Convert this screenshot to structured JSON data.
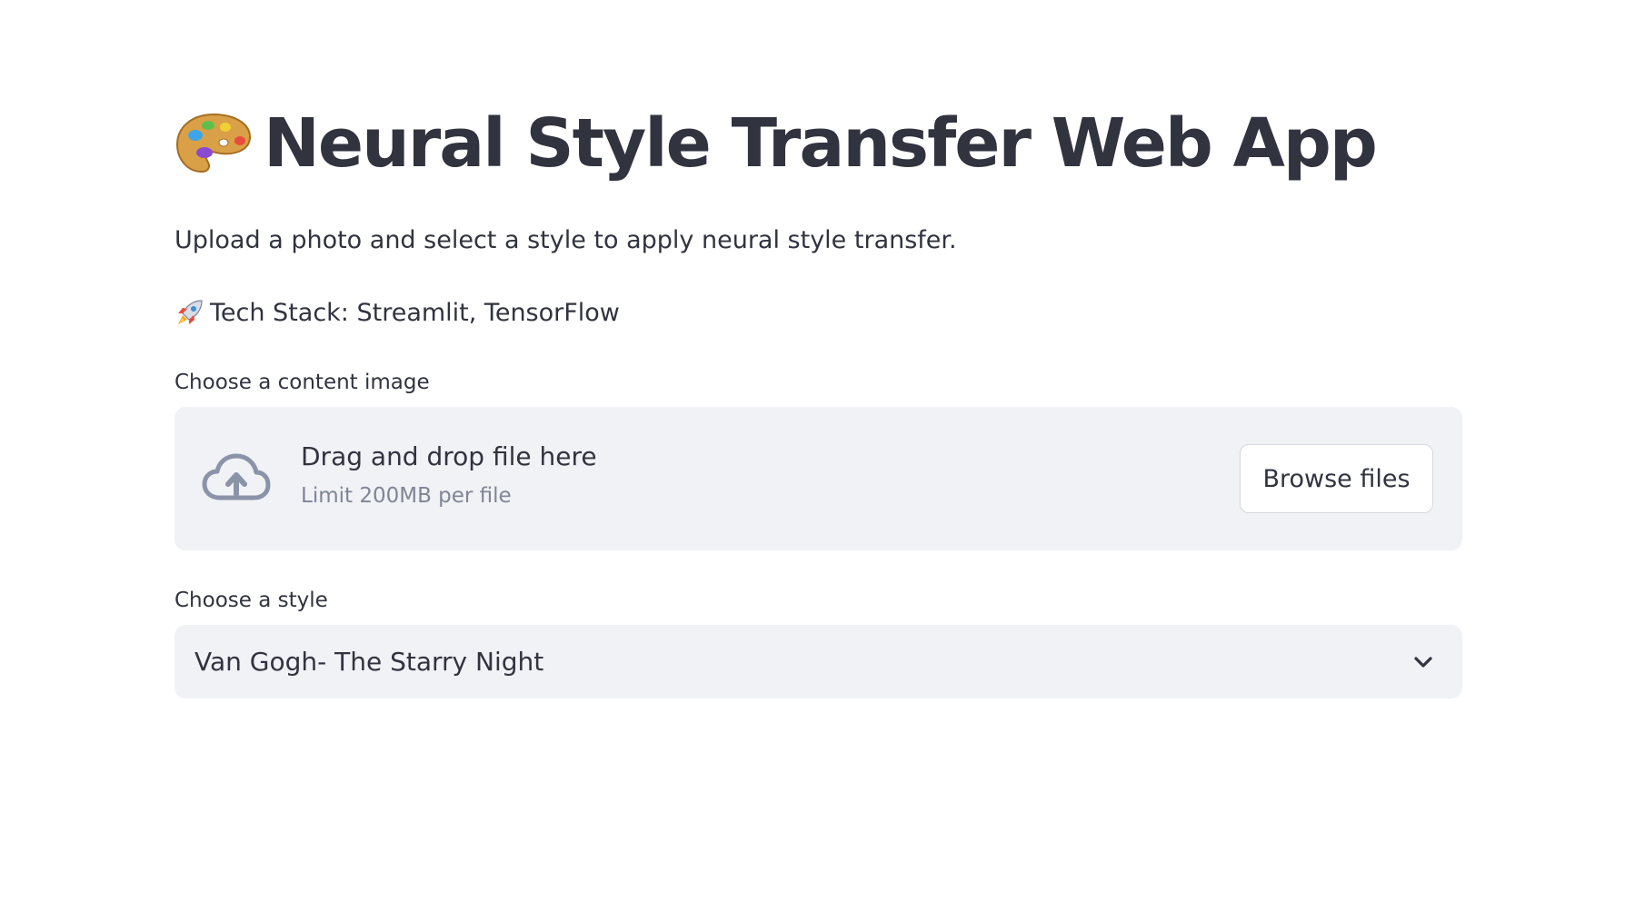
{
  "header": {
    "title": "Neural Style Transfer Web App",
    "title_icon": "artist-palette-icon"
  },
  "intro": {
    "description": "Upload a photo and select a style to apply neural style transfer.",
    "tech_stack": "Tech Stack: Streamlit, TensorFlow",
    "tech_icon": "rocket-icon"
  },
  "uploader": {
    "label": "Choose a content image",
    "drop_title": "Drag and drop file here",
    "limit": "Limit 200MB per file",
    "button_label": "Browse files",
    "icon": "cloud-upload-icon"
  },
  "style_select": {
    "label": "Choose a style",
    "selected": "Van Gogh- The Starry Night",
    "icon": "chevron-down-icon"
  },
  "colors": {
    "text": "#31333f",
    "muted": "#808495",
    "panel": "#f0f2f6",
    "border": "#d5d7de",
    "icon": "#8b93a8"
  }
}
